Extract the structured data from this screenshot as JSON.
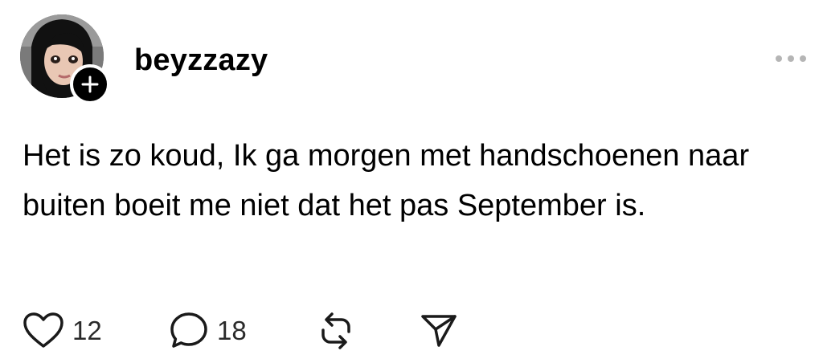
{
  "post": {
    "author": {
      "username": "beyzzazy",
      "avatar_icon": "profile-photo",
      "follow_icon": "plus-icon"
    },
    "menu_icon": "ellipsis-icon",
    "text": "Het is zo koud, Ik ga morgen met handschoenen naar buiten boeit me niet dat het pas September is.",
    "actions": {
      "like": {
        "icon": "heart-icon",
        "count": "12"
      },
      "comment": {
        "icon": "comment-icon",
        "count": "18"
      },
      "repost": {
        "icon": "repost-icon"
      },
      "share": {
        "icon": "send-icon"
      }
    }
  },
  "colors": {
    "text": "#000000",
    "icon": "#1a1a1a",
    "muted": "#b5b5b5",
    "background": "#ffffff"
  }
}
